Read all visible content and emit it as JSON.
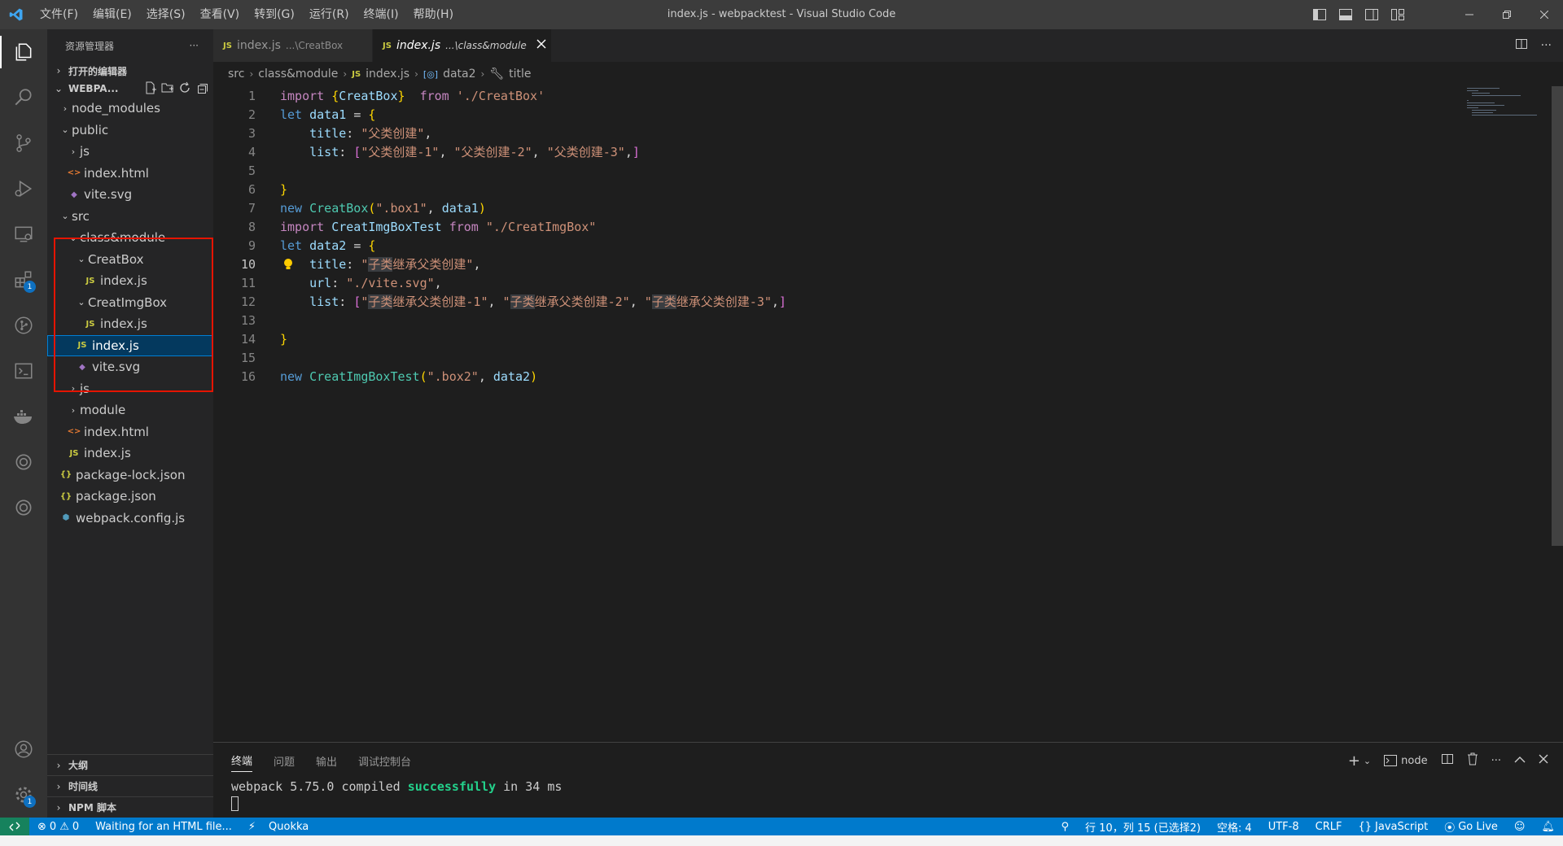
{
  "app": {
    "window_title": "index.js - webpacktest - Visual Studio Code",
    "menu": [
      "文件(F)",
      "编辑(E)",
      "选择(S)",
      "查看(V)",
      "转到(G)",
      "运行(R)",
      "终端(I)",
      "帮助(H)"
    ],
    "window_controls": [
      "minimize",
      "restore",
      "close"
    ]
  },
  "sidebar": {
    "title": "资源管理器",
    "more": "···",
    "open_editors": "打开的编辑器",
    "project": "WEBPA...",
    "tree": [
      {
        "label": "node_modules",
        "type": "folder",
        "open": false
      },
      {
        "label": "public",
        "type": "folder",
        "open": true
      },
      {
        "label": "js",
        "type": "folder",
        "open": false
      },
      {
        "label": "index.html",
        "type": "html"
      },
      {
        "label": "vite.svg",
        "type": "svg"
      },
      {
        "label": "src",
        "type": "folder",
        "open": true
      },
      {
        "label": "class&module",
        "type": "folder",
        "open": true
      },
      {
        "label": "CreatBox",
        "type": "folder",
        "open": true
      },
      {
        "label": "index.js",
        "type": "js"
      },
      {
        "label": "CreatImgBox",
        "type": "folder",
        "open": true
      },
      {
        "label": "index.js",
        "type": "js"
      },
      {
        "label": "index.js",
        "type": "js",
        "selected": true
      },
      {
        "label": "vite.svg",
        "type": "svg"
      },
      {
        "label": "js",
        "type": "folder",
        "open": false
      },
      {
        "label": "module",
        "type": "folder",
        "open": false
      },
      {
        "label": "index.html",
        "type": "html"
      },
      {
        "label": "index.js",
        "type": "js"
      },
      {
        "label": "package-lock.json",
        "type": "json"
      },
      {
        "label": "package.json",
        "type": "json"
      },
      {
        "label": "webpack.config.js",
        "type": "config"
      }
    ],
    "bottom_sections": [
      "大纲",
      "时间线",
      "NPM 脚本"
    ],
    "badge_extensions": "1",
    "badge_settings": "1"
  },
  "tabs": [
    {
      "name": "index.js",
      "desc": "...\\CreatBox",
      "active": false
    },
    {
      "name": "index.js",
      "desc": "...\\class&module",
      "active": true
    }
  ],
  "breadcrumb": [
    "src",
    "class&module",
    "index.js",
    "data2",
    "title"
  ],
  "editor": {
    "current_line": 10,
    "lines": [
      "import {CreatBox}  from './CreatBox'",
      "let data1 = {",
      "    title: \"父类创建\",",
      "    list: [\"父类创建-1\", \"父类创建-2\", \"父类创建-3\",]",
      "",
      "}",
      "new CreatBox(\".box1\", data1)",
      "import CreatImgBoxTest from \"./CreatImgBox\"",
      "let data2 = {",
      "    title: \"子类继承父类创建\",",
      "    url: \"./vite.svg\",",
      "    list: [\"子类继承父类创建-1\", \"子类继承父类创建-2\", \"子类继承父类创建-3\",]",
      "",
      "}",
      "",
      "new CreatImgBoxTest(\".box2\", data2)"
    ]
  },
  "panel": {
    "tabs": [
      "终端",
      "问题",
      "输出",
      "调试控制台"
    ],
    "active_tab": "终端",
    "terminal_name": "node",
    "output_prefix": "webpack 5.75.0 compiled ",
    "output_ok": "successfully",
    "output_suffix": " in 34 ms"
  },
  "statusbar": {
    "errors": "0",
    "warnings": "0",
    "message": "Waiting for an HTML file...",
    "quokka": "Quokka",
    "position": "行 10，列 15 (已选择2)",
    "spaces": "空格: 4",
    "encoding": "UTF-8",
    "eol": "CRLF",
    "language": "JavaScript",
    "golive": "Go Live"
  },
  "colors": {
    "accent": "#007acc",
    "highlight_box": "#e51400",
    "keyword": "#569cd6",
    "string": "#ce9178",
    "class": "#4ec9b0",
    "variable": "#9cdcfe"
  }
}
